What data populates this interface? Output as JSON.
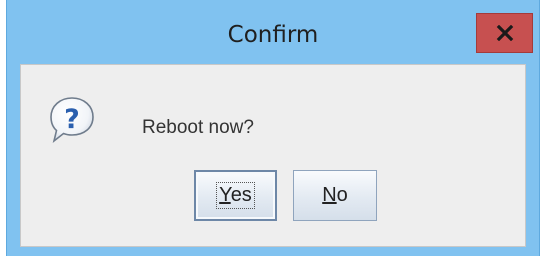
{
  "window": {
    "title": "Confirm",
    "close_icon": "close-icon"
  },
  "message": {
    "icon": "question-icon",
    "text": "Reboot now?"
  },
  "buttons": {
    "yes": {
      "mnemonic": "Y",
      "rest": "es"
    },
    "no": {
      "mnemonic": "N",
      "rest": "o"
    }
  },
  "colors": {
    "frame": "#80c2f0",
    "close_button": "#c75050",
    "dialog_background": "#eeeeee",
    "icon_blue": "#2a5fae"
  }
}
